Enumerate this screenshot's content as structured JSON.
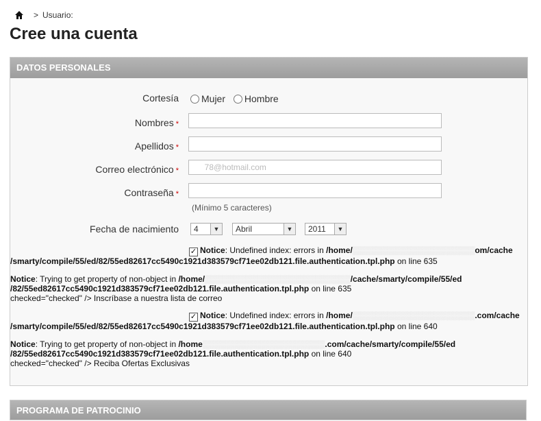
{
  "breadcrumb": {
    "sep": ">",
    "current": "Usuario:"
  },
  "page_title": "Cree una cuenta",
  "section": {
    "title": "DATOS PERSONALES"
  },
  "form": {
    "courtesy_label": "Cortesía",
    "courtesy_options": [
      "Mujer",
      "Hombre"
    ],
    "first_name_label": "Nombres",
    "last_name_label": "Apellidos",
    "email_label": "Correo electrónico",
    "email_value": "     78@hotmail.com",
    "password_label": "Contraseña",
    "password_hint": "(Mínimo 5 caracteres)",
    "birthdate_label": "Fecha de nacimiento",
    "day": "4",
    "month": "Abril",
    "year": "2011",
    "required_mark": "*"
  },
  "notices": [
    {
      "line1_bold": "Notice",
      "line1_text": ": Undefined index: errors in ",
      "line1_path_a": "/home/",
      "line1_path_b": "om/cache",
      "line2": "/smarty/compile/55/ed/82/55ed82617cc5490c1921d383579cf71ee02db121.file.authentication.tpl.php",
      "line2_suffix": " on line 635"
    },
    {
      "line1_bold": "Notice",
      "line1_text": ": Trying to get property of non-object in ",
      "line1_path_a": "/home/",
      "line1_path_b": "/cache/smarty/compile/55/ed",
      "line2": "/82/55ed82617cc5490c1921d383579cf71ee02db121.file.authentication.tpl.php",
      "line2_suffix": " on line 635",
      "line3": "checked=\"checked\" /> Inscríbase a nuestra lista de correo"
    },
    {
      "line1_bold": "Notice",
      "line1_text": ": Undefined index: errors in ",
      "line1_path_a": "/home/",
      "line1_path_b": ".com/cache",
      "line2": "/smarty/compile/55/ed/82/55ed82617cc5490c1921d383579cf71ee02db121.file.authentication.tpl.php",
      "line2_suffix": " on line 640"
    },
    {
      "line1_bold": "Notice",
      "line1_text": ": Trying to get property of non-object in ",
      "line1_path_a": "/home",
      "line1_path_b": ".com/cache/smarty/compile/55/ed",
      "line2": "/82/55ed82617cc5490c1921d383579cf71ee02db121.file.authentication.tpl.php",
      "line2_suffix": " on line 640",
      "line3": "checked=\"checked\" /> Reciba Ofertas Exclusivas"
    }
  ],
  "section2": {
    "title": "PROGRAMA DE PATROCINIO"
  }
}
